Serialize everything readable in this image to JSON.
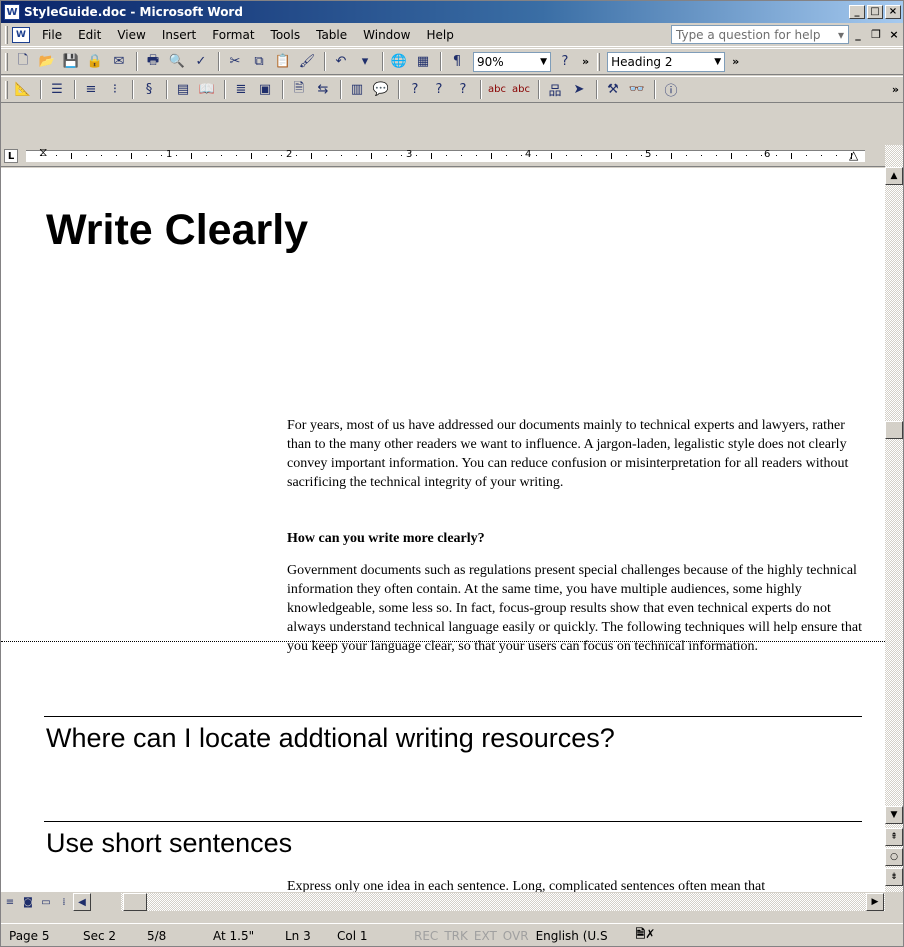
{
  "window": {
    "title": "StyleGuide.doc - Microsoft Word"
  },
  "menu": {
    "items": [
      "File",
      "Edit",
      "View",
      "Insert",
      "Format",
      "Tools",
      "Table",
      "Window",
      "Help"
    ],
    "ask_placeholder": "Type a question for help"
  },
  "toolbar": {
    "zoom": "90%",
    "style": "Heading 2",
    "standard_icons": [
      "new-document-icon",
      "open-icon",
      "save-icon",
      "permission-icon",
      "research-icon",
      "print-icon",
      "print-preview-icon",
      "spelling-icon",
      "cut-icon",
      "copy-icon",
      "paste-icon",
      "format-painter-icon",
      "undo-icon",
      "insert-hyperlink-icon",
      "tables-icon",
      "show-formatting-icon",
      "help-icon"
    ],
    "secondary_icons": [
      "word-count-icon",
      "outline-icon",
      "numbering-icon",
      "bullets-icon",
      "style-icon",
      "table-icon",
      "bookmark-icon",
      "paragraph-icon",
      "picture-icon",
      "caption-icon",
      "cross-reference-icon",
      "chart-icon",
      "comment-icon",
      "help-1-icon",
      "help-2-icon",
      "help-3-icon",
      "spell-abc-icon",
      "spell-abc-2-icon",
      "tree-icon",
      "arrow-icon",
      "hammer-icon",
      "glasses-icon",
      "info-icon"
    ]
  },
  "ruler": {
    "numbers": [
      "1",
      "2",
      "3",
      "4",
      "5",
      "6"
    ]
  },
  "document": {
    "heading": "Write Clearly",
    "intro": "For years, most of us have addressed our documents mainly to technical experts and lawyers, rather than to the many other readers we want to influence. A jargon-laden, legalistic style does not clearly convey important information. You can reduce confusion or misinterpretation for all readers without sacrificing the technical integrity of your writing.",
    "question": "How can you write more clearly?",
    "para2": "Government documents such as regulations present special challenges because of the highly technical information they often contain. At the same time, you have multiple audiences, some highly knowledgeable, some less so. In fact, focus-group results show that even technical experts do not always understand technical language easily or quickly. The following techniques will help ensure that you keep your language clear, so that your users can focus on technical information.",
    "heading2": "Where can I locate addtional writing resources?",
    "heading3": "Use short sentences",
    "para3": "Express only one idea in each sentence. Long, complicated sentences often mean that"
  },
  "status": {
    "page": "Page 5",
    "sec": "Sec 2",
    "pages": "5/8",
    "at": "At 1.5\"",
    "ln": "Ln 3",
    "col": "Col 1",
    "rec": "REC",
    "trk": "TRK",
    "ext": "EXT",
    "ovr": "OVR",
    "language": "English (U.S"
  },
  "colors": {
    "titlebar": "#0a246a",
    "face": "#d4d0c8"
  }
}
